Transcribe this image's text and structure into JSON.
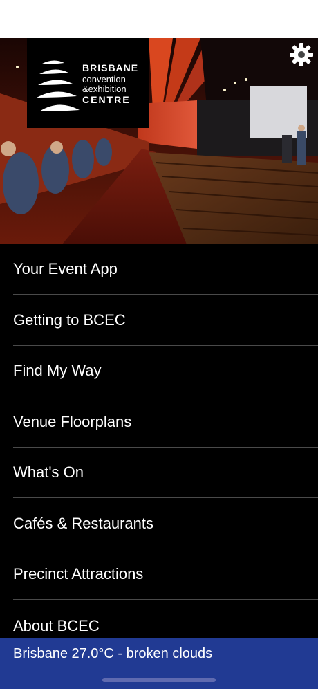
{
  "logo": {
    "line1": "BRISBANE",
    "line2": "convention",
    "line3": "&exhibition",
    "line4": "CENTRE"
  },
  "icons": {
    "settings": "gear-icon",
    "logo_mark": "bcec-wave-logo"
  },
  "menu": {
    "items": [
      {
        "label": "Your Event App"
      },
      {
        "label": "Getting to BCEC"
      },
      {
        "label": "Find My Way"
      },
      {
        "label": "Venue Floorplans"
      },
      {
        "label": "What's On"
      },
      {
        "label": "Cafés & Restaurants"
      },
      {
        "label": "Precinct Attractions"
      },
      {
        "label": "About BCEC"
      }
    ]
  },
  "weather": {
    "text": "Brisbane 27.0°C - broken clouds"
  },
  "colors": {
    "menu_background": "#000000",
    "weather_bar": "#213a93",
    "divider": "#4a4a4a"
  }
}
